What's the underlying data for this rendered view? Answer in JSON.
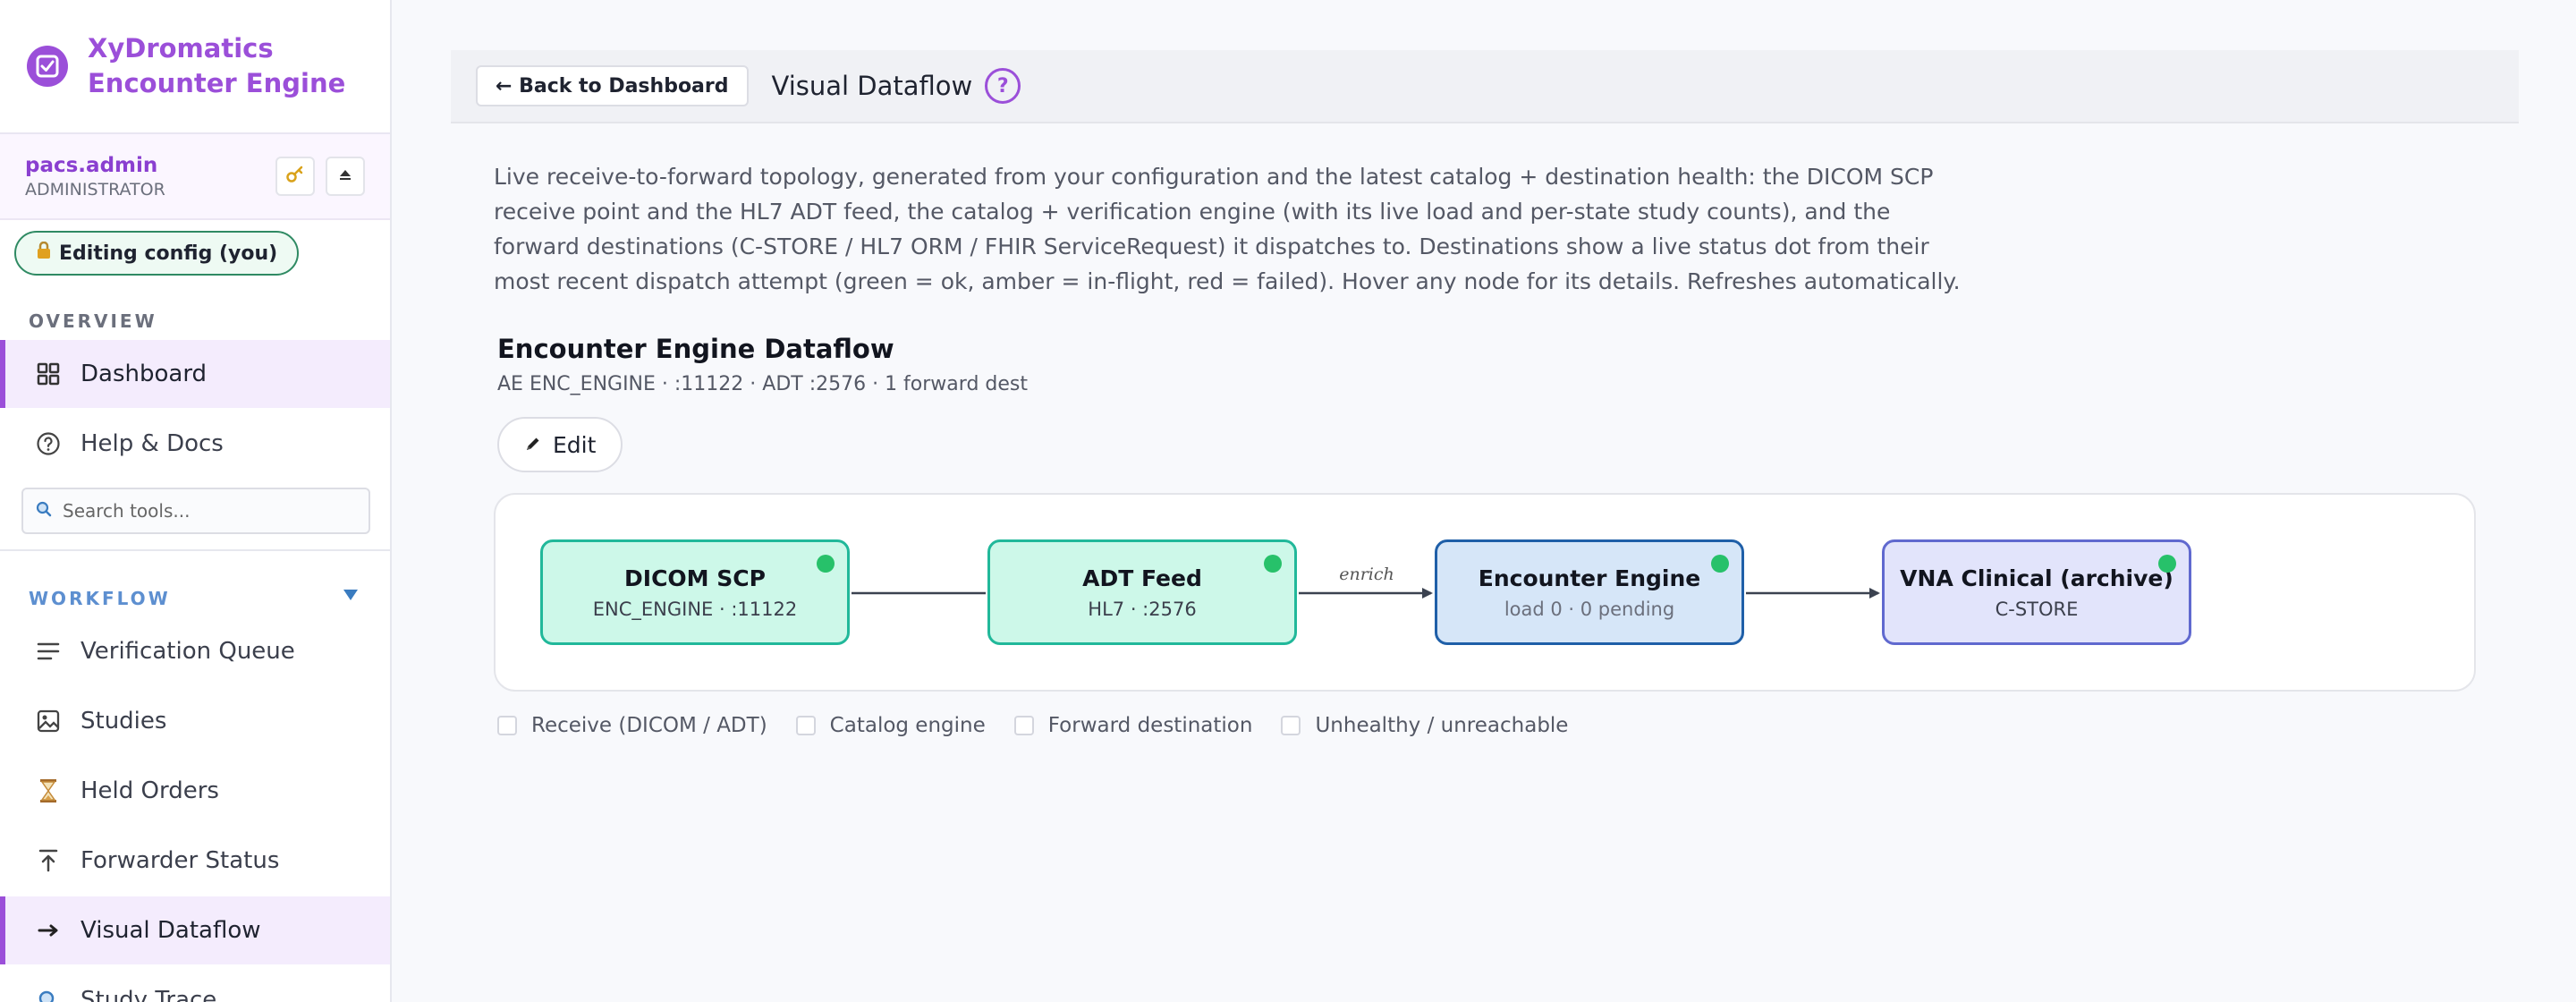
{
  "brand": {
    "title_line1": "XyDromatics",
    "title_line2": "Encounter Engine"
  },
  "user": {
    "name": "pacs.admin",
    "role": "ADMINISTRATOR",
    "key_icon": "key-icon",
    "eject_icon": "eject-icon"
  },
  "editing": {
    "label": "Editing config (you)"
  },
  "sidebar": {
    "overview_label": "OVERVIEW",
    "overview_items": [
      {
        "label": "Dashboard",
        "icon": "grid-icon"
      },
      {
        "label": "Help & Docs",
        "icon": "help-circle-icon"
      }
    ],
    "search_placeholder": "Search tools...",
    "workflow_label": "WORKFLOW",
    "workflow_items": [
      {
        "label": "Verification Queue",
        "icon": "list-icon"
      },
      {
        "label": "Studies",
        "icon": "image-icon"
      },
      {
        "label": "Held Orders",
        "icon": "hourglass-icon"
      },
      {
        "label": "Forwarder Status",
        "icon": "upload-icon"
      },
      {
        "label": "Visual Dataflow",
        "icon": "arrow-right-icon"
      },
      {
        "label": "Study Trace",
        "icon": "search-icon"
      }
    ],
    "active_item": "Visual Dataflow"
  },
  "header": {
    "back_label": "← Back to Dashboard",
    "title": "Visual Dataflow",
    "help": "?"
  },
  "description": "Live receive-to-forward topology, generated from your configuration and the latest catalog + destination health: the DICOM SCP receive point and the HL7 ADT feed, the catalog + verification engine (with its live load and per-state study counts), and the forward destinations (C-STORE / HL7 ORM / FHIR ServiceRequest) it dispatches to. Destinations show a live status dot from their most recent dispatch attempt (green = ok, amber = in-flight, red = failed). Hover any node for its details. Refreshes automatically.",
  "flow": {
    "title": "Encounter Engine Dataflow",
    "subtitle": "AE ENC_ENGINE · :11122 · ADT :2576 · 1 forward dest",
    "edit_label": "Edit",
    "nodes": [
      {
        "title": "DICOM SCP",
        "sub": "ENC_ENGINE · :11122",
        "kind": "receive",
        "status": "ok"
      },
      {
        "title": "ADT Feed",
        "sub": "HL7 · :2576",
        "kind": "receive",
        "status": "ok"
      },
      {
        "title": "Encounter Engine",
        "sub": "load 0 · 0 pending",
        "kind": "engine",
        "status": "ok"
      },
      {
        "title": "VNA Clinical (archive)",
        "sub": "C-STORE",
        "kind": "destination",
        "status": "ok"
      }
    ],
    "edge_label": "enrich",
    "legend": [
      "Receive (DICOM / ADT)",
      "Catalog engine",
      "Forward destination",
      "Unhealthy / unreachable"
    ]
  },
  "colors": {
    "accent": "#9b4fd9",
    "receive_fill": "#cdf8e9",
    "receive_border": "#21b89a",
    "engine_fill": "#d6e6f8",
    "engine_border": "#1f5fa8",
    "dest_fill": "#e2e4fb",
    "dest_border": "#6069cf",
    "status_ok": "#27c16a"
  }
}
